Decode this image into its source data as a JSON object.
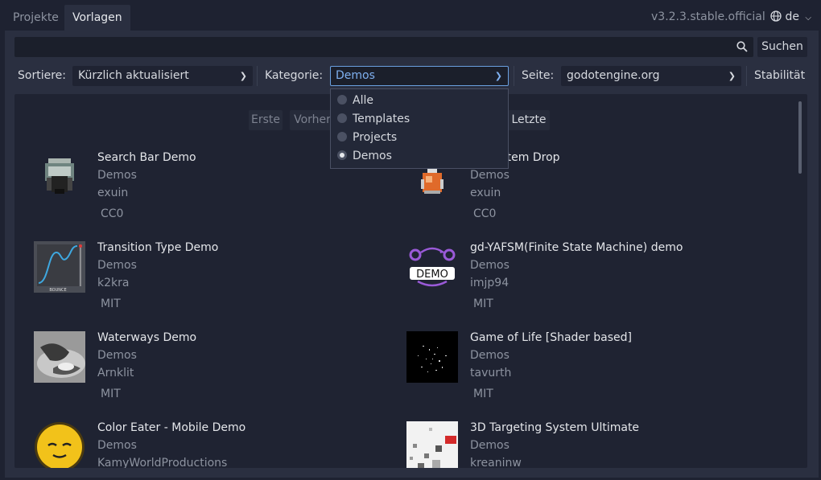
{
  "tabs": [
    {
      "label": "Projekte",
      "active": false
    },
    {
      "label": "Vorlagen",
      "active": true
    }
  ],
  "version": "v3.2.3.stable.official",
  "language": "de",
  "search": {
    "placeholder": "",
    "button": "Suchen"
  },
  "filters": {
    "sort_label": "Sortiere:",
    "sort_value": "Kürzlich aktualisiert",
    "category_label": "Kategorie:",
    "category_value": "Demos",
    "site_label": "Seite:",
    "site_value": "godotengine.org",
    "stability_button": "Stabilität"
  },
  "pagination": {
    "first": "Erste",
    "prev": "Vorher",
    "last": "Letzte"
  },
  "category_options": [
    {
      "label": "Alle",
      "selected": false
    },
    {
      "label": "Templates",
      "selected": false
    },
    {
      "label": "Projects",
      "selected": false
    },
    {
      "label": "Demos",
      "selected": true
    }
  ],
  "assets": [
    {
      "title": "Search Bar Demo",
      "category": "Demos",
      "author": "exuin",
      "license": "CC0"
    },
    {
      "title": "Basic Item Drop",
      "category": "Demos",
      "author": "exuin",
      "license": "CC0"
    },
    {
      "title": "Transition Type Demo",
      "category": "Demos",
      "author": "k2kra",
      "license": "MIT"
    },
    {
      "title": "gd-YAFSM(Finite State Machine) demo",
      "category": "Demos",
      "author": "imjp94",
      "license": "MIT"
    },
    {
      "title": "Waterways Demo",
      "category": "Demos",
      "author": "Arnklit",
      "license": "MIT"
    },
    {
      "title": "Game of Life [Shader based]",
      "category": "Demos",
      "author": "tavurth",
      "license": "MIT"
    },
    {
      "title": "Color Eater - Mobile Demo",
      "category": "Demos",
      "author": "KamyWorldProductions",
      "license": ""
    },
    {
      "title": "3D Targeting System Ultimate",
      "category": "Demos",
      "author": "kreaninw",
      "license": ""
    }
  ],
  "thumb_labels": {
    "bounce": "BOUNCE",
    "demo": "DEMO"
  }
}
